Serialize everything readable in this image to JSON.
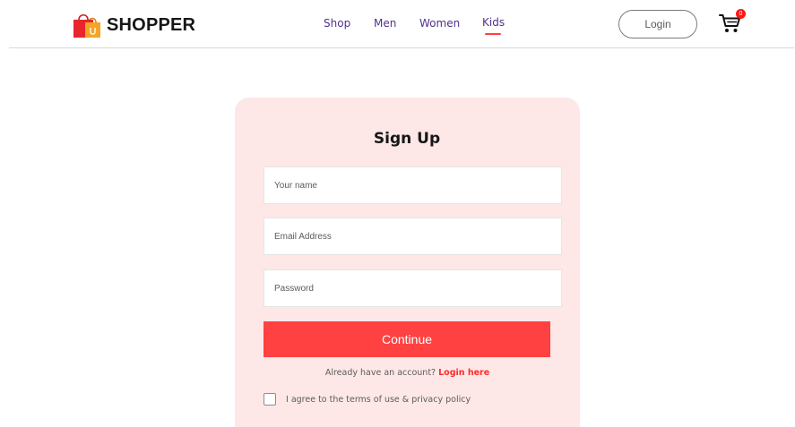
{
  "brand": {
    "name": "SHOPPER",
    "logo_icon": "shopping-bags-icon"
  },
  "nav": {
    "items": [
      {
        "label": "Shop",
        "active": false
      },
      {
        "label": "Men",
        "active": false
      },
      {
        "label": "Women",
        "active": false
      },
      {
        "label": "Kids",
        "active": true
      }
    ],
    "login_label": "Login",
    "cart": {
      "icon": "cart-icon",
      "count": "0"
    }
  },
  "signup": {
    "title": "Sign Up",
    "fields": {
      "name_placeholder": "Your name",
      "email_placeholder": "Email Address",
      "password_placeholder": "Password"
    },
    "continue_label": "Continue",
    "have_account_text": "Already have an account?",
    "login_link_label": "Login here",
    "agree_label": "I agree to the terms of use & privacy policy",
    "agree_checked": false
  },
  "colors": {
    "accent": "#ff4141",
    "nav_text": "#52318a",
    "card_background": "#fde7e7",
    "badge": "#ff1616"
  }
}
